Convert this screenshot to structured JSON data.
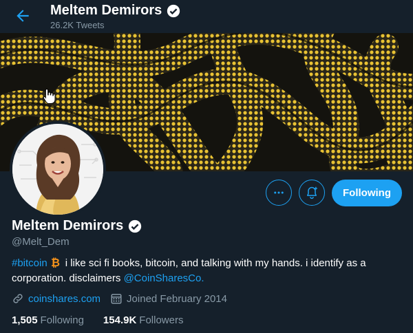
{
  "header": {
    "title": "Meltem Demirors",
    "tweet_count": "26.2K Tweets"
  },
  "profile": {
    "name": "Meltem Demirors",
    "handle": "@Melt_Dem",
    "bio": {
      "hashtag": "#bitcoin",
      "text1": "i like sci fi books, bitcoin, and talking with my hands. i identify as a corporation. disclaimers",
      "mention": "@CoinSharesCo."
    },
    "website": "coinshares.com",
    "joined": "Joined February 2014",
    "following_count": "1,505",
    "following_label": "Following",
    "followers_count": "154.9K",
    "followers_label": "Followers"
  },
  "actions": {
    "following_button": "Following"
  },
  "icons": {
    "back": "arrow-left-icon",
    "verified": "verified-badge-icon",
    "more": "more-dots-icon",
    "bell": "notification-bell-icon",
    "link": "link-icon",
    "calendar": "calendar-icon",
    "bitcoin": "bitcoin-icon"
  },
  "colors": {
    "background": "#15202b",
    "accent": "#1da1f2",
    "muted": "#8899a6",
    "banner_yellow": "#e8c233"
  }
}
